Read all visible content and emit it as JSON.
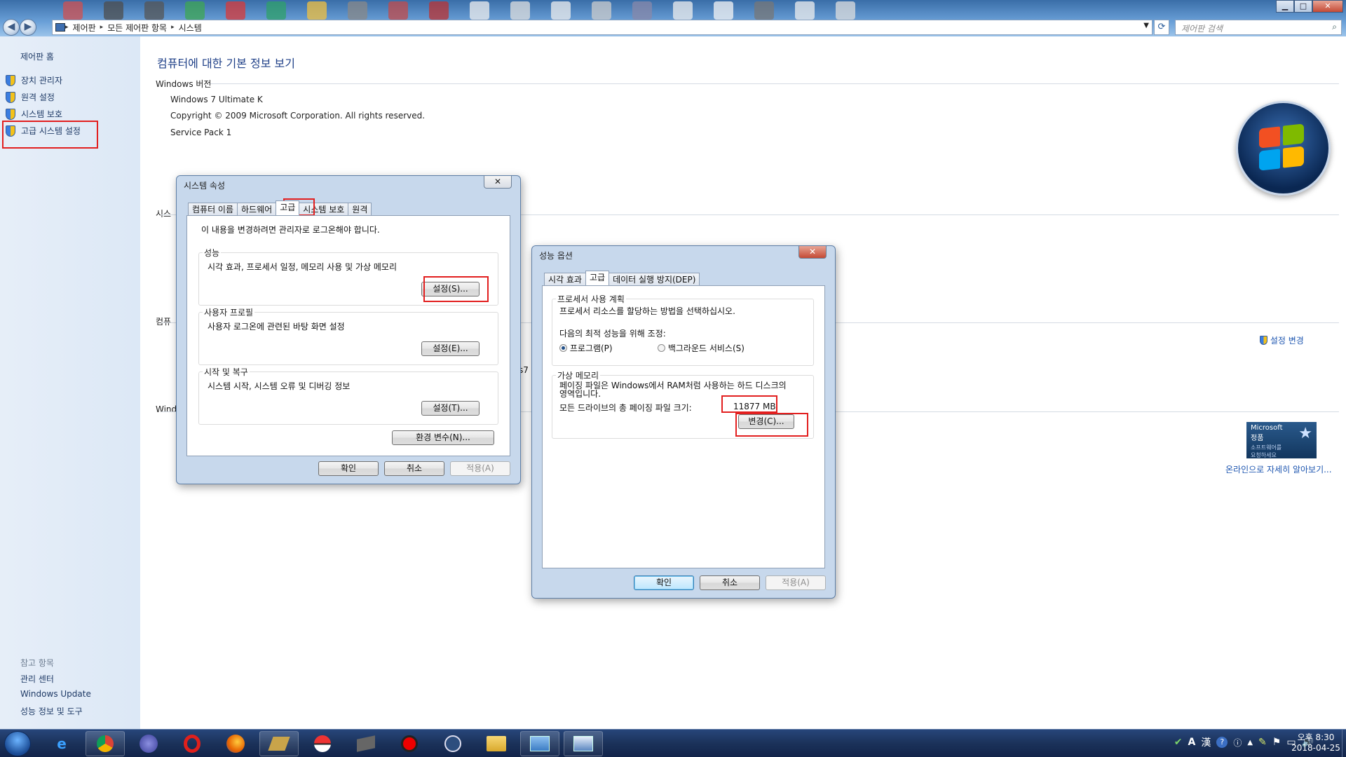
{
  "window": {
    "address_crumbs": [
      "제어판",
      "모든 제어판 항목",
      "시스템"
    ],
    "search_placeholder": "제어판 검색",
    "controls": {
      "minimize": "▁",
      "maximize": "□",
      "close": "✕"
    }
  },
  "left_pane": {
    "home": "제어판 홈",
    "items": [
      {
        "label": "장치 관리자",
        "icon": "shield-icon"
      },
      {
        "label": "원격 설정",
        "icon": "shield-icon"
      },
      {
        "label": "시스템 보호",
        "icon": "shield-icon"
      },
      {
        "label": "고급 시스템 설정",
        "icon": "shield-icon",
        "highlighted": true
      }
    ],
    "see_also_title": "참고 항목",
    "see_also": [
      "관리 센터",
      "Windows Update",
      "성능 정보 및 도구"
    ]
  },
  "main": {
    "heading": "컴퓨터에 대한 기본 정보 보기",
    "windows_edition_title": "Windows 버전",
    "edition": "Windows 7 Ultimate K",
    "copyright": "Copyright © 2009 Microsoft Corporation. All rights reserved.",
    "service_pack": "Service Pack 1",
    "partial_sections": [
      "시스",
      "컴퓨",
      "Wind"
    ],
    "partial_fragment": "s7",
    "change_settings_link": "설정 변경",
    "genuine_badge": {
      "title": "Microsoft",
      "sub1": "정품",
      "sub2": "소프트웨어를",
      "sub3": "요청하세요"
    },
    "learn_more_link": "온라인으로 자세히 알아보기..."
  },
  "system_properties": {
    "title": "시스템 속성",
    "close": "✕",
    "tabs": [
      "컴퓨터 이름",
      "하드웨어",
      "고급",
      "시스템 보호",
      "원격"
    ],
    "active_tab": "고급",
    "admin_notice": "이 내용을 변경하려면 관리자로 로그온해야 합니다.",
    "performance": {
      "title": "성능",
      "desc": "시각 효과, 프로세서 일정, 메모리 사용 및 가상 메모리",
      "button": "설정(S)..."
    },
    "user_profile": {
      "title": "사용자 프로필",
      "desc": "사용자 로그온에 관련된 바탕 화면 설정",
      "button": "설정(E)..."
    },
    "startup_recovery": {
      "title": "시작 및 복구",
      "desc": "시스템 시작, 시스템 오류 및 디버깅 정보",
      "button": "설정(T)..."
    },
    "env_button": "환경 변수(N)...",
    "ok": "확인",
    "cancel": "취소",
    "apply": "적용(A)"
  },
  "performance_options": {
    "title": "성능 옵션",
    "close": "✕",
    "tabs": [
      "시각 효과",
      "고급",
      "데이터 실행 방지(DEP)"
    ],
    "active_tab": "고급",
    "scheduling": {
      "title": "프로세서 사용 계획",
      "desc": "프로세서 리소스를 할당하는 방법을 선택하십시오.",
      "adjust_label": "다음의 최적 성능을 위해 조정:",
      "option_programs": "프로그램(P)",
      "option_background": "백그라운드 서비스(S)",
      "selected": "프로그램(P)"
    },
    "virtual_memory": {
      "title": "가상 메모리",
      "desc_line1": "페이징 파일은 Windows에서 RAM처럼 사용하는 하드 디스크의",
      "desc_line2": "영역입니다.",
      "total_label": "모든 드라이브의 총 페이징 파일 크기:",
      "total_value": "11877 MB",
      "change_button": "변경(C)..."
    },
    "ok": "확인",
    "cancel": "취소",
    "apply": "적용(A)"
  },
  "taskbar": {
    "apps": [
      "ie-icon",
      "chrome-icon",
      "app-s-icon",
      "opera-icon",
      "firefox-icon",
      "app-tool-icon",
      "app-pokeball-icon",
      "app-book-icon",
      "app-record-icon",
      "app-tree-icon",
      "explorer-icon",
      "control-panel-icon",
      "system-icon"
    ],
    "tray_glyphs": [
      "✔",
      "A",
      "漢",
      "?",
      "ⓘ",
      "▲",
      "✎",
      "⚑",
      "▭",
      "🔊"
    ],
    "clock_time": "오후 8:30",
    "clock_date": "2018-04-25"
  },
  "colors": {
    "highlight": "#e21f1f",
    "link": "#1e56b0",
    "heading": "#1e3f87"
  }
}
